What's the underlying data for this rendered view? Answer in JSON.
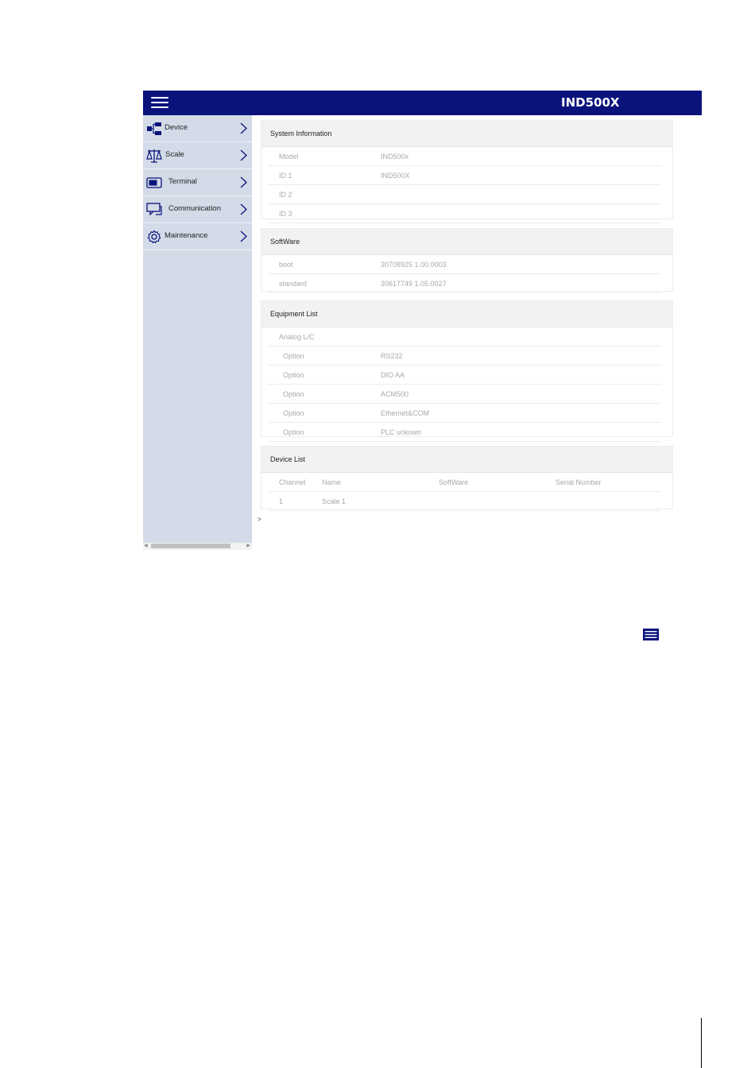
{
  "app": {
    "title": "IND500X"
  },
  "sidebar": {
    "items": [
      {
        "label": "Device",
        "icon": "device-tree-icon"
      },
      {
        "label": "Scale",
        "icon": "balance-scale-icon"
      },
      {
        "label": "Terminal",
        "icon": "terminal-display-icon"
      },
      {
        "label": "Communication",
        "icon": "communication-icon"
      },
      {
        "label": "Maintenance",
        "icon": "gear-icon"
      }
    ]
  },
  "system_information": {
    "title": "System Information",
    "rows": [
      {
        "key": "Model",
        "value": "IND500x"
      },
      {
        "key": "ID 1",
        "value": "IND500X"
      },
      {
        "key": "ID 2",
        "value": ""
      },
      {
        "key": "ID 3",
        "value": ""
      }
    ]
  },
  "software": {
    "title": "SoftWare",
    "rows": [
      {
        "key": "boot",
        "value": "30708925 1.00.0003"
      },
      {
        "key": "standard",
        "value": "30617749 1.05.0027"
      }
    ]
  },
  "equipment_list": {
    "title": "Equipment List",
    "rows": [
      {
        "key": "Analog L/C",
        "value": ""
      },
      {
        "key": "Option",
        "value": "RS232"
      },
      {
        "key": "Option",
        "value": "DIO AA"
      },
      {
        "key": "Option",
        "value": "ACM500"
      },
      {
        "key": "Option",
        "value": "Ethernet&COM"
      },
      {
        "key": "Option",
        "value": "PLC unkown"
      }
    ]
  },
  "device_list": {
    "title": "Device List",
    "columns": [
      "Channel",
      "Name",
      "SoftWare",
      "Serial Number"
    ],
    "rows": [
      [
        "1",
        "Scale 1",
        "",
        ""
      ]
    ]
  },
  "footer": {
    "breadcrumb_mark": ">"
  },
  "colors": {
    "topbar": "#0a137c",
    "sidebar": "#d3dbe8",
    "panel_header": "#f2f2f2",
    "value_text": "#a9a9a9"
  }
}
